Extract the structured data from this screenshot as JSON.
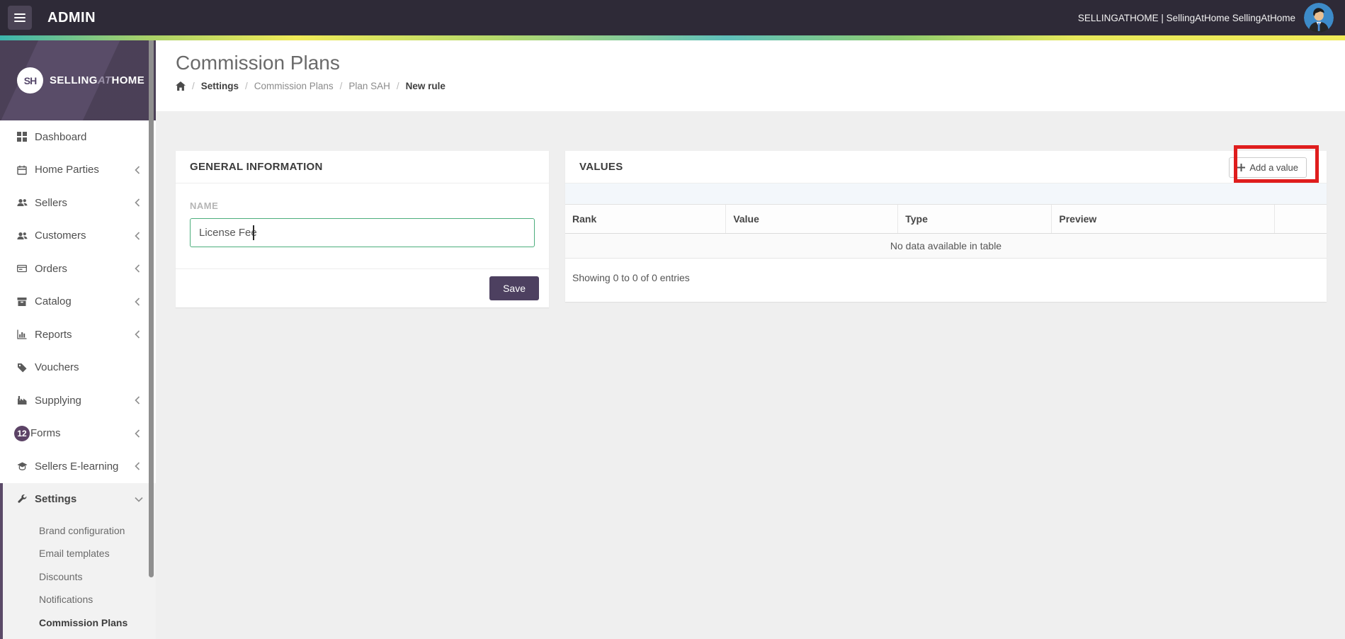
{
  "topbar": {
    "brand": "ADMIN",
    "user_label": "SELLINGATHOME | SellingAtHome SellingAtHome"
  },
  "sidebar": {
    "logo": {
      "badge": "SH",
      "name_selling": "SELLING",
      "name_at": "AT",
      "name_home": "HOME"
    },
    "items": [
      {
        "label": "Dashboard"
      },
      {
        "label": "Home Parties"
      },
      {
        "label": "Sellers"
      },
      {
        "label": "Customers"
      },
      {
        "label": "Orders"
      },
      {
        "label": "Catalog"
      },
      {
        "label": "Reports"
      },
      {
        "label": "Vouchers"
      },
      {
        "label": "Supplying"
      },
      {
        "label": "Forms",
        "badge": "12"
      },
      {
        "label": "Sellers E-learning"
      }
    ],
    "settings": {
      "label": "Settings",
      "children": [
        {
          "label": "Brand configuration"
        },
        {
          "label": "Email templates"
        },
        {
          "label": "Discounts"
        },
        {
          "label": "Notifications"
        },
        {
          "label": "Commission Plans"
        }
      ],
      "active_child": "Commission Plans"
    }
  },
  "header": {
    "title": "Commission Plans",
    "breadcrumb_separator": "/",
    "breadcrumb": [
      {
        "label": "Settings"
      },
      {
        "label": "Commission Plans"
      },
      {
        "label": "Plan SAH"
      },
      {
        "label": "New rule"
      }
    ]
  },
  "general_panel": {
    "title": "GENERAL INFORMATION",
    "name_label": "NAME",
    "name_value": "License Fee",
    "save_label": "Save"
  },
  "values_panel": {
    "title": "VALUES",
    "add_value_label": "Add a value",
    "columns": [
      "Rank",
      "Value",
      "Type",
      "Preview"
    ],
    "empty_text": "No data available in table",
    "footer_text": "Showing 0 to 0 of 0 entries"
  },
  "colors": {
    "topbar_bg": "#2e2a37",
    "sidebar_accent_purple": "#5b4a68",
    "save_button_purple": "#4d4060",
    "input_focus_green": "#4cae7c",
    "annotation_red": "#df1d1d",
    "badge_purple": "#5c4366",
    "avatar_blue": "#3d8bc9",
    "gradient_stops": [
      "#3cb5ae",
      "#f1eb58",
      "#5fc0bb",
      "#f1eb58"
    ]
  }
}
